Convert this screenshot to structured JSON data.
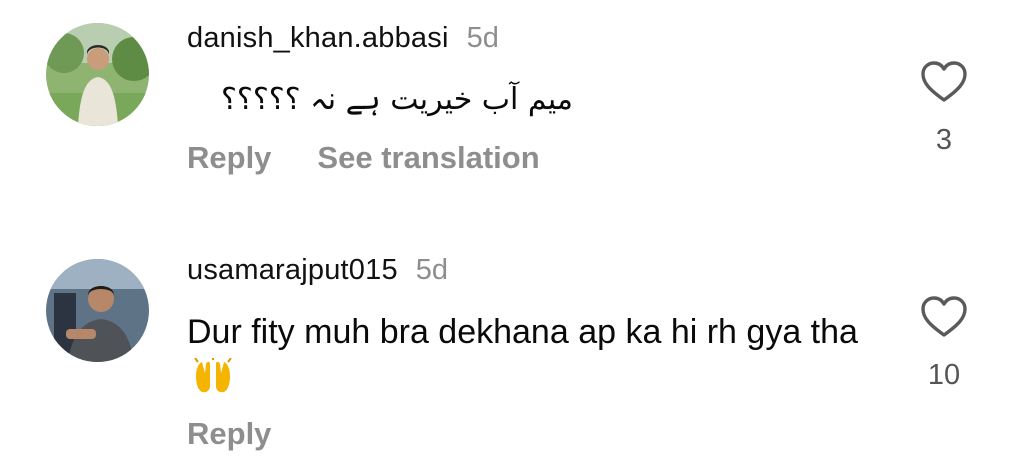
{
  "comments": [
    {
      "username": "danish_khan.abbasi",
      "time": "5d",
      "text": "میم آب خیریت ہے نہ ؟؟؟؟؟",
      "actions": {
        "reply": "Reply",
        "translate": "See translation"
      },
      "likes": "3",
      "avatar_icon": "person-outdoors-avatar"
    },
    {
      "username": "usamarajput015",
      "time": "5d",
      "text": "Dur fity muh bra dekhana ap ka hi rh gya tha",
      "emoji": "raising-hands-emoji",
      "actions": {
        "reply": "Reply"
      },
      "likes": "10",
      "avatar_icon": "person-indoors-avatar"
    }
  ],
  "colors": {
    "secondary_text": "#8e8e8e",
    "primary_text": "#0a0a0a",
    "heart_outline": "#5a5a5a"
  }
}
